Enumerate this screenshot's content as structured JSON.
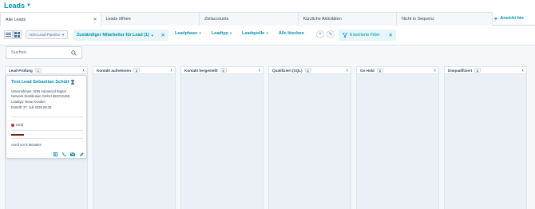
{
  "header": {
    "title": "Leads"
  },
  "tabs": [
    {
      "label": "Alle Leads",
      "closable": true,
      "active": true
    },
    {
      "label": "Leads öffnen",
      "closable": false,
      "active": false
    },
    {
      "label": "Zielaccounts",
      "closable": false,
      "active": false
    },
    {
      "label": "Kürzliche Aktivitäten",
      "closable": false,
      "active": false
    },
    {
      "label": "Nicht in Sequenz",
      "closable": false,
      "active": false
    }
  ],
  "add_view": {
    "label": "Ansicht hin"
  },
  "toolbar": {
    "pipeline_value": "ADN Lead-Pipeline",
    "owner_filter": "Zuständiger Mitarbeiter für Lead (1)",
    "leadphase": "Leadphase",
    "leadtyp": "Leadtyp",
    "leadquelle": "Leadquelle",
    "clear_all": "Alle löschen",
    "advanced_filter": "Erweiterte Filter"
  },
  "search": {
    "placeholder": "Suchen"
  },
  "columns": [
    {
      "label": "Lead-Prüfung",
      "count": "1"
    },
    {
      "label": "Kontakt aufnehmen",
      "count": "0"
    },
    {
      "label": "Kontakt hergestellt",
      "count": "0"
    },
    {
      "label": "Qualifiziert (SQL)",
      "count": "0"
    },
    {
      "label": "On Hold",
      "count": "0"
    },
    {
      "label": "Disqualifiziert",
      "count": "0"
    }
  ],
  "card": {
    "name": "Test Lead Sebastian Schütt",
    "company_line1": "Unternehmen: ADN Advanced Digital",
    "company_line2": "Network Distribution GmbH (BOCHUM)",
    "leadtype": "Leadtyp: Neue Kunden",
    "created": "Erstellt: 27. Juli 2026 09:33",
    "priority": "Heiß",
    "reminder": "Anruf vor 6 Monaten"
  },
  "colors": {
    "accent": "#0091ae",
    "text": "#33475b",
    "board_bg": "#f5f8fa",
    "column_bg": "#eaf0f6",
    "priority_hot": "#c0392b"
  },
  "icons": [
    "grid-view-icon",
    "list-view-icon",
    "search-icon",
    "close-icon",
    "plus-icon",
    "pencil-icon",
    "filter-icon",
    "chevron-left-icon",
    "hourglass-icon",
    "task-icon",
    "phone-icon",
    "email-icon",
    "edit-icon"
  ]
}
